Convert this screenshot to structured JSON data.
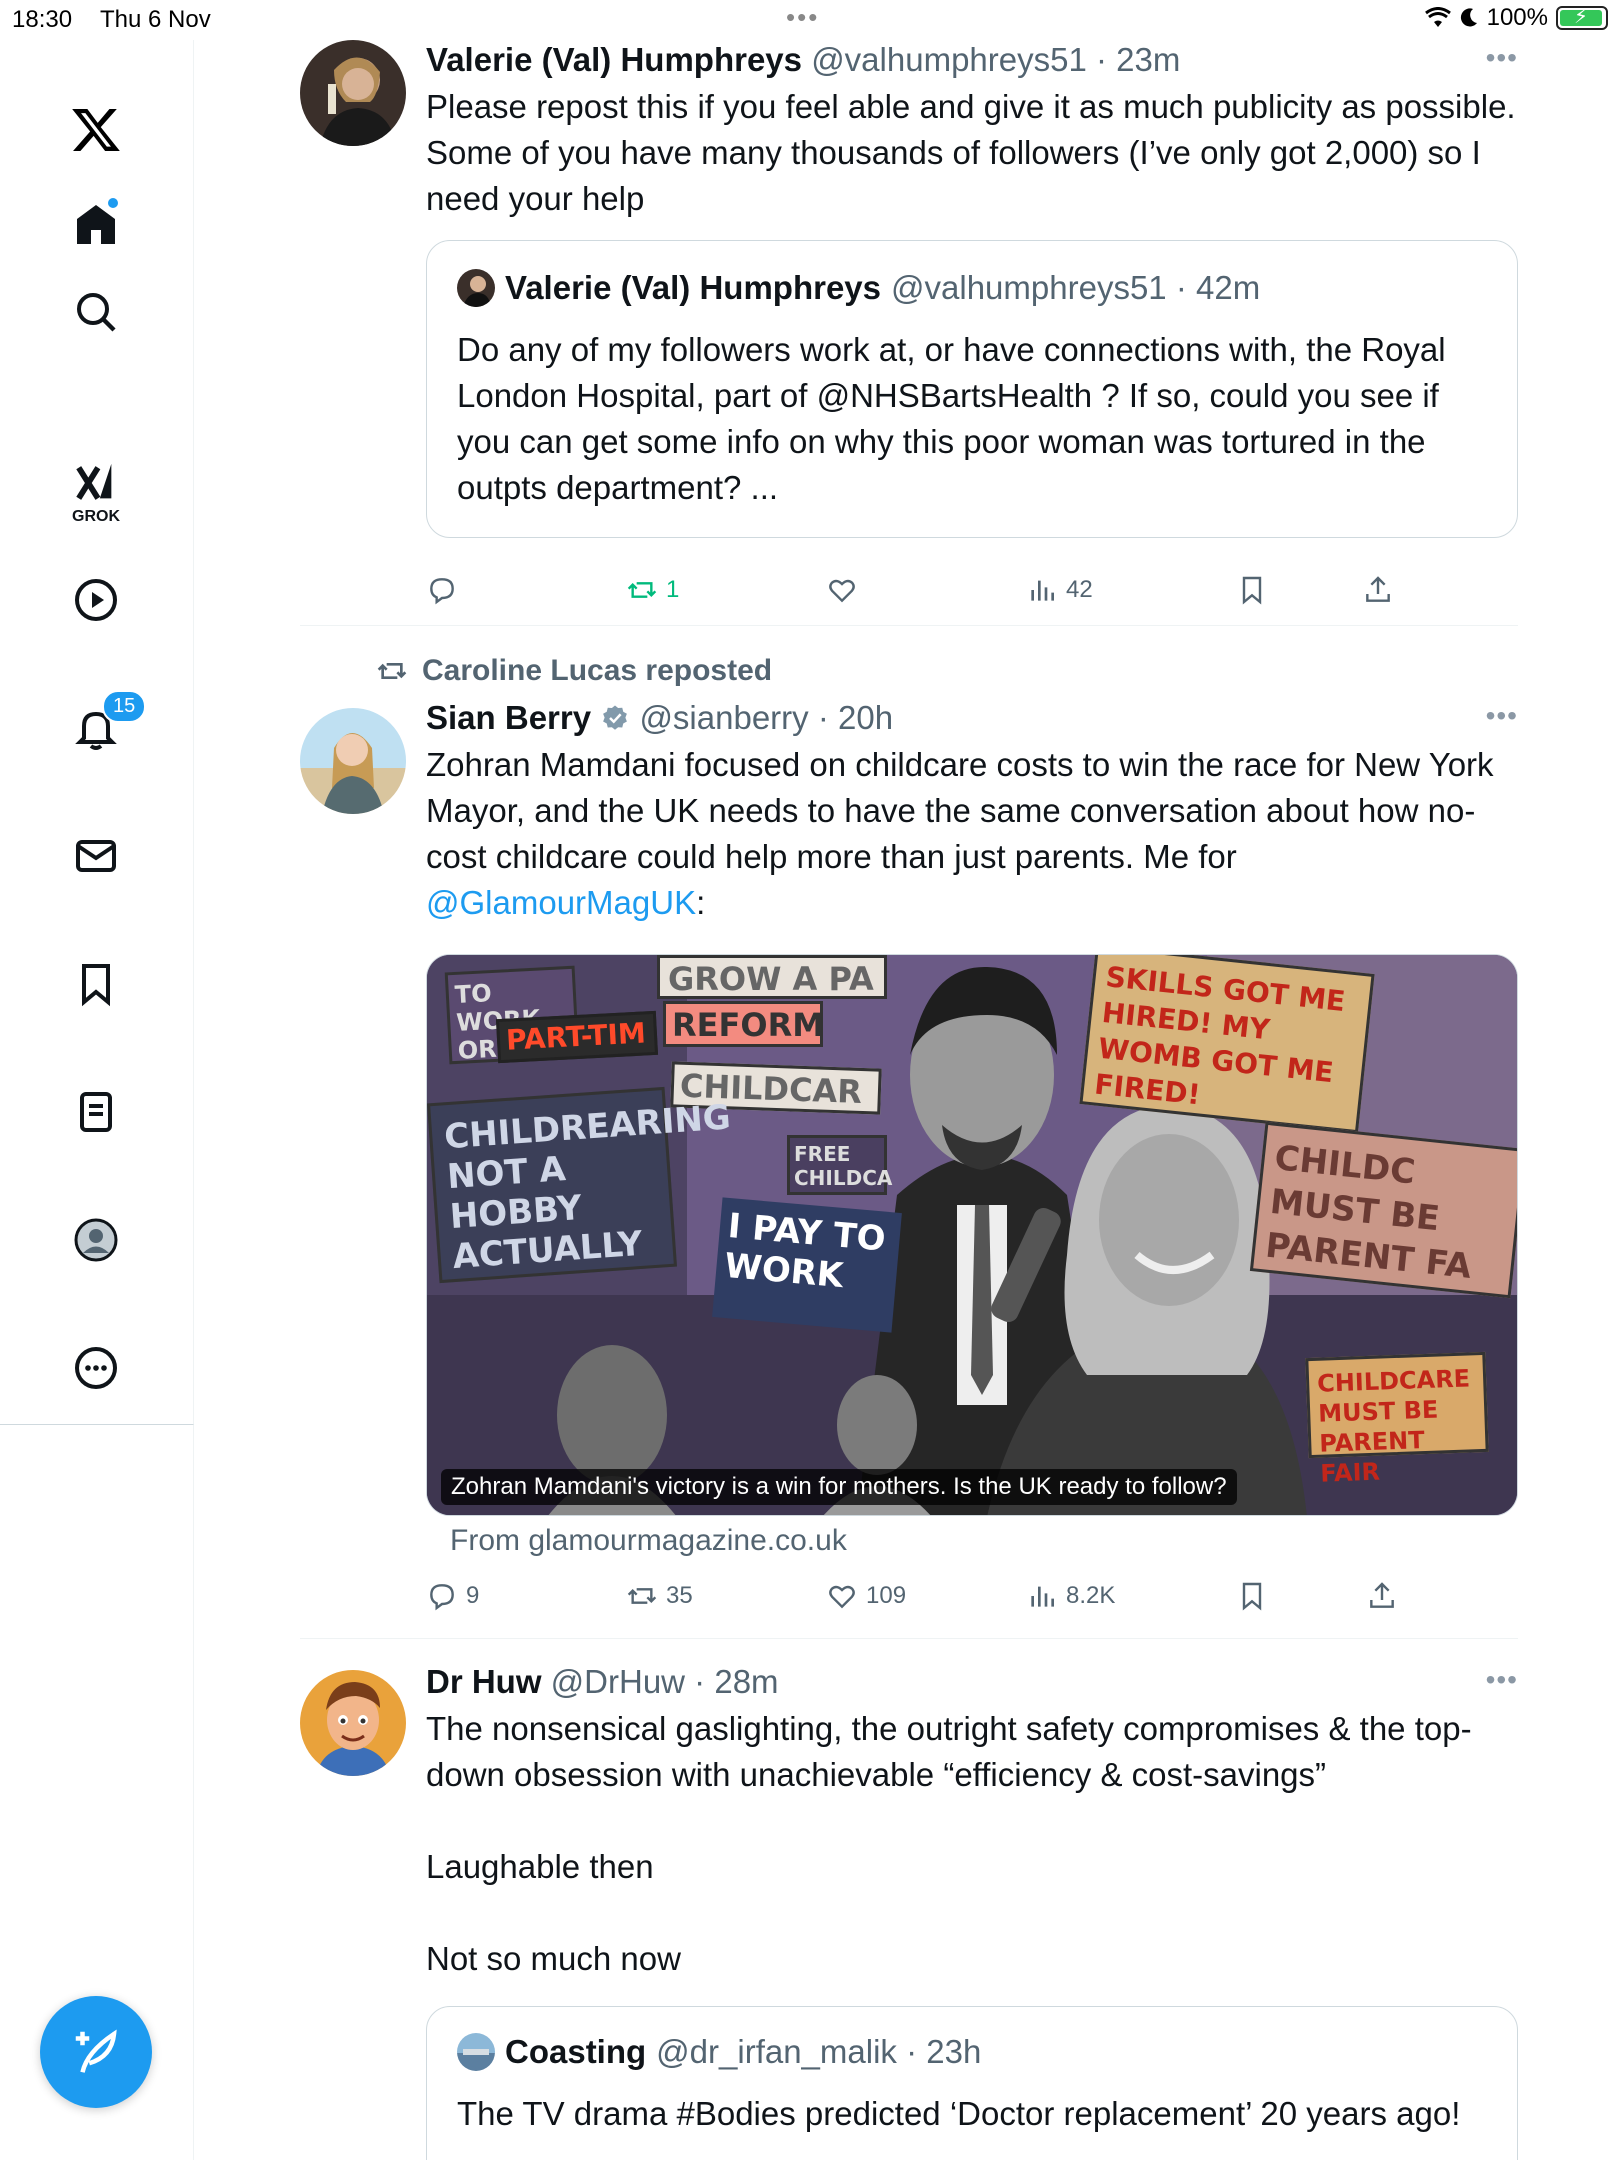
{
  "status_bar": {
    "time": "18:30",
    "date": "Thu 6 Nov",
    "battery": "100%"
  },
  "sidebar": {
    "logo": "𝕏",
    "grok_label": "GROK",
    "notifications_badge": "15",
    "items": [
      "x-logo-icon",
      "home-icon",
      "search-icon",
      "grok-icon",
      "video-icon",
      "bell-icon",
      "mail-icon",
      "bookmark-icon",
      "lists-icon",
      "profile-icon",
      "more-icon"
    ]
  },
  "tweets": [
    {
      "name": "Valerie (Val) Humphreys",
      "handle": "@valhumphreys51",
      "time": "23m",
      "text": "Please repost this if you feel able and give it as much publicity as possible. Some of you have many thousands of followers (I’ve only got 2,000) so I need your help",
      "quote": {
        "name": "Valerie (Val) Humphreys",
        "handle": "@valhumphreys51",
        "time": "42m",
        "text": "Do any of my followers work at, or have connections with, the Royal London Hospital, part of @NHSBartsHealth ? If so, could you see if you can get some info on why this poor woman was tortured in the outpts department? ..."
      },
      "actions": {
        "replies": "",
        "reposts": "1",
        "likes": "",
        "views": "42"
      }
    },
    {
      "reposted_by": "Caroline Lucas reposted",
      "name": "Sian Berry",
      "handle": "@sianberry",
      "time": "20h",
      "text_main": "Zohran Mamdani focused on childcare costs to win the race for New York Mayor, and the UK needs to have the same conversation about how no-cost childcare could help more than just parents. Me for ",
      "text_link": "@GlamourMagUK",
      "text_end": ":",
      "media_caption": "Zohran Mamdani's victory is a win for mothers. Is the UK ready to follow?",
      "media_source": "From glamourmagazine.co.uk",
      "signs": {
        "s1": "TO WORK OR",
        "s2": "PART-TIM",
        "s3": "GROW A PA",
        "s4": "REFORM",
        "s5": "CHILDCAR",
        "s6": "CHILDREARING NOT A HOBBY ACTUALLY",
        "s7": "FREE CHILDCA",
        "s8": "I PAY TO WORK",
        "s9": "SKILLS GOT ME HIRED! MY WOMB GOT ME FIRED!",
        "s10": "CHILDC MUST BE PARENT FA",
        "s11": "CHILDCARE MUST BE PARENT FAIR"
      },
      "actions": {
        "replies": "9",
        "reposts": "35",
        "likes": "109",
        "views": "8.2K"
      }
    },
    {
      "name": "Dr Huw",
      "handle": "@DrHuw",
      "time": "28m",
      "text": "The nonsensical gaslighting, the outright safety compromises & the top-down obsession with unachievable “efficiency & cost-savings”",
      "text2": "Laughable then",
      "text3": "Not so much now",
      "quote": {
        "name": "Coasting",
        "handle": "@dr_irfan_malik",
        "time": "23h",
        "text": "The TV drama #Bodies predicted ‘Doctor replacement’ 20 years ago!"
      }
    }
  ],
  "colors": {
    "accent": "#1d9bf0",
    "repost_green": "#00ba7c",
    "muted": "#536471"
  }
}
